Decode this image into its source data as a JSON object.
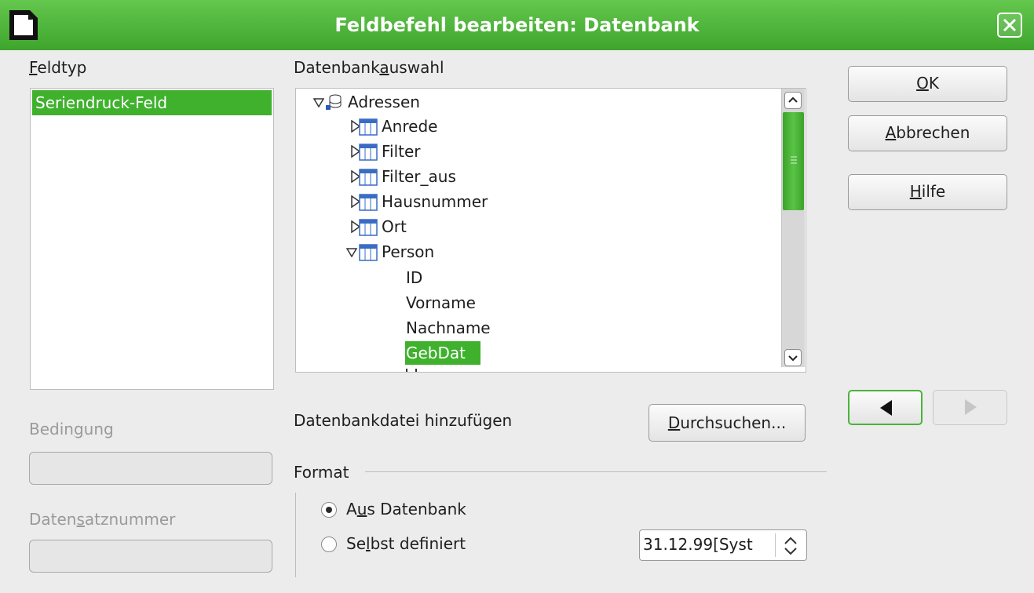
{
  "window": {
    "title": "Feldbefehl bearbeiten: Datenbank"
  },
  "feldtyp": {
    "label_mnemonic": "F",
    "label_rest": "eldtyp",
    "items": [
      "Seriendruck-Feld"
    ],
    "selected": "Seriendruck-Feld"
  },
  "bedingung": {
    "label_pre": "Bedin",
    "label_mnemonic": "g",
    "label_post": "ung",
    "value": ""
  },
  "datensatznummer": {
    "label_pre": "Daten",
    "label_mnemonic": "s",
    "label_post": "atznummer",
    "value": ""
  },
  "datenbankauswahl": {
    "label_pre": "Datenbank",
    "label_mnemonic": "a",
    "label_post": "uswahl",
    "root": "Adressen",
    "tables": [
      "Anrede",
      "Filter",
      "Filter_aus",
      "Hausnummer",
      "Ort",
      "Person"
    ],
    "expanded_table": "Person",
    "fields": [
      "ID",
      "Vorname",
      "Nachname",
      "GebDat"
    ],
    "selected_field": "GebDat"
  },
  "add_db": {
    "label": "Datenbankdatei hinzufügen",
    "browse_mnemonic": "D",
    "browse_rest": "urchsuchen..."
  },
  "format": {
    "legend": "Format",
    "option_db_pre": "A",
    "option_db_mnemonic": "u",
    "option_db_post": "s Datenbank",
    "option_user_pre": "Se",
    "option_user_mnemonic": "l",
    "option_user_post": "bst definiert",
    "selected": "Aus Datenbank",
    "format_value": "31.12.99[Syst"
  },
  "buttons": {
    "ok_mnemonic": "O",
    "ok_rest": "K",
    "cancel_mnemonic": "A",
    "cancel_rest": "bbrechen",
    "help_mnemonic": "H",
    "help_rest": "ilfe"
  },
  "colors": {
    "accent": "#3fb12d",
    "titlebar": "#4cb63a",
    "disabled_text": "#9a9a9a"
  }
}
